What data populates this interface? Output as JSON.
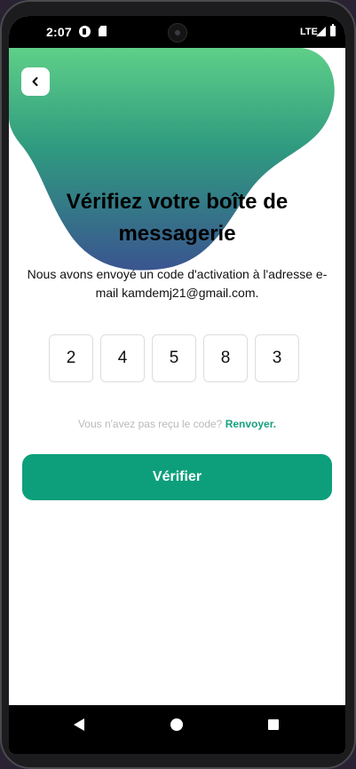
{
  "status_bar": {
    "time": "2:07",
    "network": "LTE"
  },
  "header": {
    "back_icon": "chevron-left-icon"
  },
  "main": {
    "title": "Vérifiez votre boîte de messagerie",
    "subtitle": "Nous avons envoyé un code d'activation à l'adresse e-mail kamdemj21@gmail.com.",
    "code_digits": [
      "2",
      "4",
      "5",
      "8",
      "3"
    ],
    "resend_prompt": "Vous n'avez pas reçu le code?",
    "resend_link": "Renvoyer.",
    "verify_label": "Vérifier"
  },
  "colors": {
    "accent": "#0d9f7b",
    "blob_top": "#5fcf88",
    "blob_bottom": "#3a5590"
  },
  "nav_bar": {
    "icons": [
      "back-icon",
      "home-icon",
      "recents-icon"
    ]
  }
}
